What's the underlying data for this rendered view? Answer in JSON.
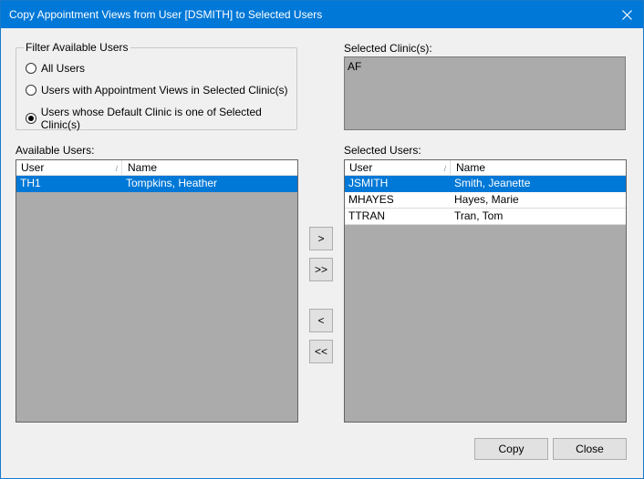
{
  "window": {
    "title": "Copy Appointment Views from User [DSMITH] to Selected Users",
    "close_glyph": "✕"
  },
  "filter": {
    "label": "Filter Available Users",
    "options": [
      {
        "label": "All Users",
        "checked": false
      },
      {
        "label": "Users with Appointment Views in Selected Clinic(s)",
        "checked": false
      },
      {
        "label": "Users whose Default Clinic is one of Selected Clinic(s)",
        "checked": true
      }
    ]
  },
  "selected_clinics": {
    "label": "Selected Clinic(s):",
    "items": [
      "AF"
    ]
  },
  "available_users": {
    "label": "Available Users:",
    "columns": [
      "User",
      "Name"
    ],
    "rows": [
      {
        "user": "TH1",
        "name": "Tompkins, Heather",
        "selected": true
      }
    ]
  },
  "selected_users": {
    "label": "Selected Users:",
    "columns": [
      "User",
      "Name"
    ],
    "rows": [
      {
        "user": "JSMITH",
        "name": "Smith, Jeanette",
        "selected": true
      },
      {
        "user": "MHAYES",
        "name": "Hayes, Marie",
        "selected": false
      },
      {
        "user": "TTRAN",
        "name": "Tran, Tom",
        "selected": false
      }
    ]
  },
  "move_buttons": {
    "add": ">",
    "add_all": ">>",
    "remove": "<",
    "remove_all": "<<"
  },
  "buttons": {
    "copy": "Copy",
    "close": "Close"
  },
  "colors": {
    "titlebar": "#0078d7",
    "selection": "#0078d7",
    "list_background": "#ababab"
  }
}
